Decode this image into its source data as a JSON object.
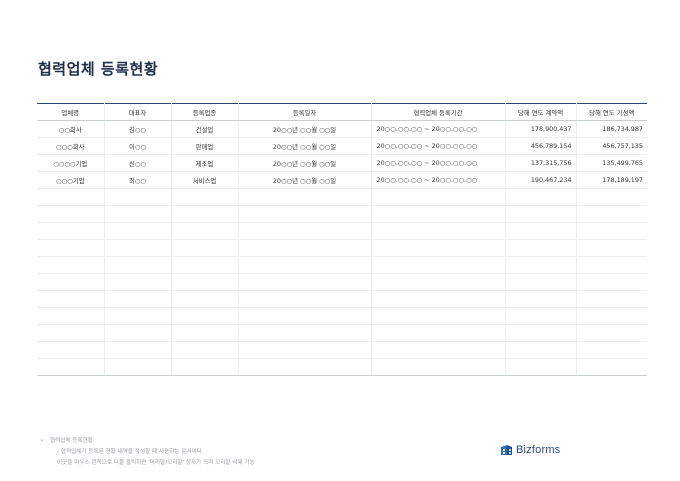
{
  "page": {
    "title": "협력업체 등록현황"
  },
  "table": {
    "headers": [
      "업체명",
      "대표자",
      "등록업종",
      "등록일자",
      "협력업체 등록기간",
      "당해 연도 계약액",
      "당해 연도 기성액"
    ],
    "rows": [
      [
        "○○회사",
        "김○○",
        "건설업",
        "20○○년 ○○월 ○○일",
        "20○○.○○.○○ ~ 20○○.○○.○○",
        "178,900,437",
        "186,734,987"
      ],
      [
        "○○○회사",
        "이○○",
        "판매업",
        "20○○년 ○○월 ○○일",
        "20○○.○○.○○ ~ 20○○.○○.○○",
        "456,789,154",
        "456,757,135"
      ],
      [
        "○○○○기업",
        "신○○",
        "제조업",
        "20○○년 ○○월 ○○일",
        "20○○.○○.○○ ~ 20○○.○○.○○",
        "137,315,756",
        "135,499,765"
      ],
      [
        "○○○기업",
        "최○○",
        "서비스업",
        "20○○년 ○○월 ○○일",
        "20○○.○○.○○ ~ 20○○.○○.○○",
        "190,467,234",
        "178,189,197"
      ]
    ],
    "empty_rows": 11
  },
  "notes": {
    "bullet": "•",
    "heading": "협력업체 등록현황",
    "line1": "- 협력업체가 등록된 현황 내역을 작성할 때 사용하는 문서이다.",
    "line2": "이곳을 마우스 왼쪽으로 더블 클릭하면 '머리말/꼬리말' 상자가 뜨며 꼬리말 삭제 가능"
  },
  "logo": {
    "text": "Bizforms",
    "icon": "bizforms-logo-icon",
    "color": "#2d4a77"
  }
}
